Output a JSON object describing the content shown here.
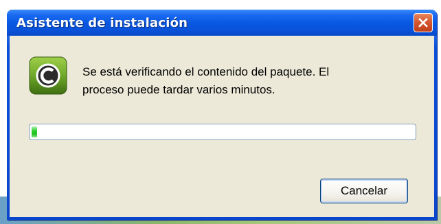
{
  "window": {
    "title": "Asistente de instalación",
    "close_icon": "close-icon"
  },
  "dialog": {
    "icon": "c-logo-icon",
    "message_line1": "Se está verificando el contenido del paquete. El",
    "message_line2": "proceso puede tardar varios minutos.",
    "progress_percent": 2,
    "cancel_label": "Cancelar"
  },
  "colors": {
    "titlebar": "#0a52d8",
    "client_bg": "#ece9d8",
    "progress_green": "#22c022",
    "close_red": "#d4552e",
    "icon_green": "#6fa82a"
  }
}
